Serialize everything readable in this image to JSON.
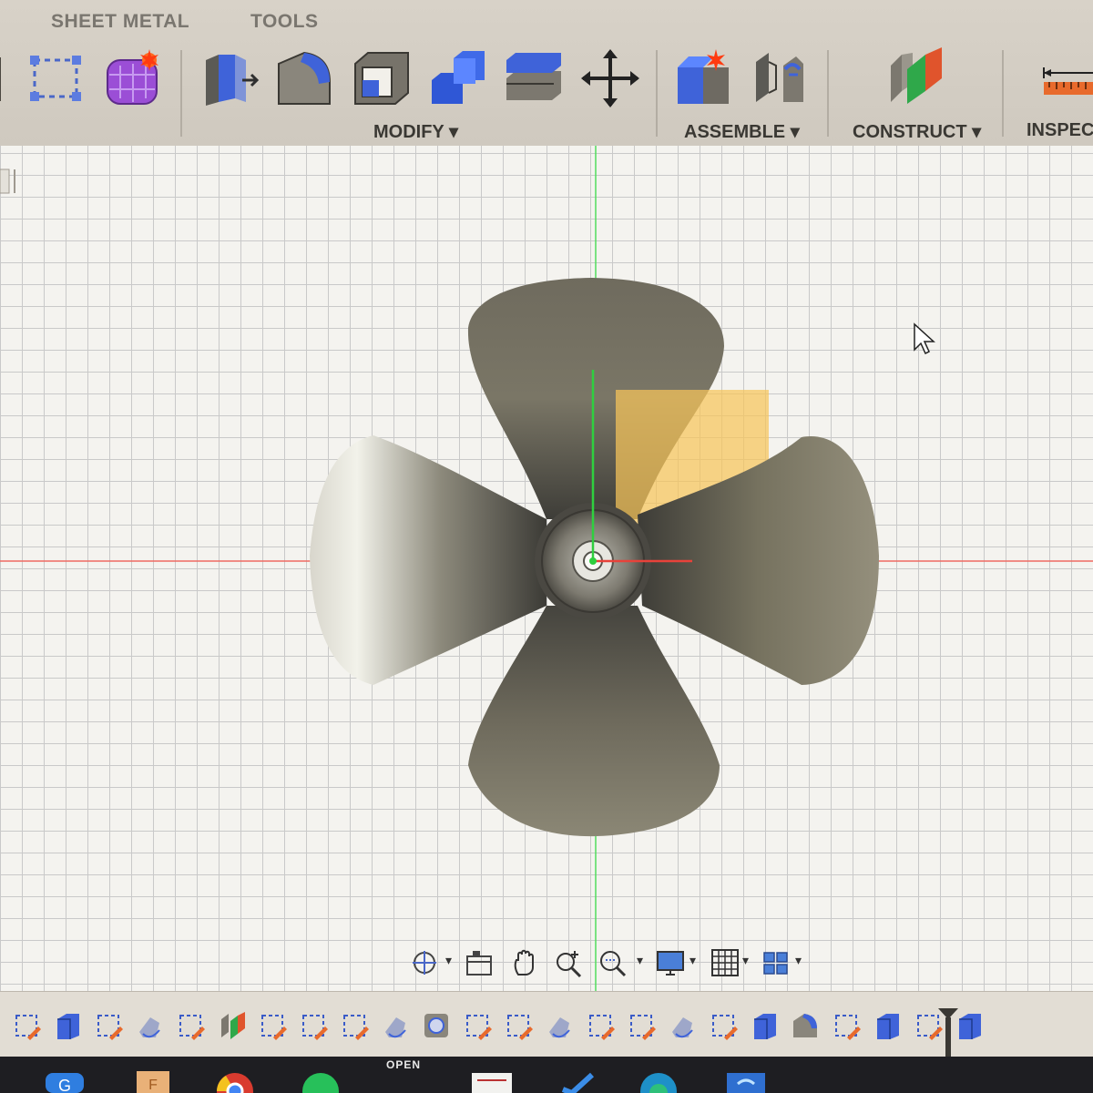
{
  "toolbar": {
    "tabs": [
      "SHEET METAL",
      "TOOLS"
    ],
    "groups": {
      "modify": "MODIFY",
      "assemble": "ASSEMBLE",
      "construct": "CONSTRUCT",
      "inspect": "INSPECT"
    },
    "tools": [
      "sketch-rectangle-icon",
      "create-form-icon",
      "press-pull-icon",
      "fillet-icon",
      "shell-icon",
      "combine-icon",
      "offset-face-icon",
      "move-copy-icon",
      "new-component-icon",
      "joint-icon",
      "offset-plane-icon",
      "measure-icon"
    ]
  },
  "viewport": {
    "model": "four-blade-propeller",
    "axis_colors": {
      "x": "#e8423a",
      "y": "#2fcf3f"
    },
    "highlight_color": "#f6c55a"
  },
  "navbar": {
    "tools": [
      "orbit-icon",
      "look-at-icon",
      "pan-icon",
      "zoom-icon",
      "fit-icon",
      "display-settings-icon",
      "grid-settings-icon",
      "viewports-icon"
    ]
  },
  "timeline": {
    "features": [
      "sketch",
      "extrude",
      "sketch",
      "revolve",
      "sketch",
      "construct-plane",
      "sketch",
      "sketch",
      "sketch",
      "revolve",
      "hole",
      "sketch",
      "sketch",
      "revolve",
      "sketch",
      "sketch",
      "revolve",
      "sketch",
      "extrude",
      "fillet",
      "sketch",
      "extrude",
      "sketch",
      "extrude"
    ]
  },
  "taskbar": {
    "open_label": "OPEN"
  }
}
